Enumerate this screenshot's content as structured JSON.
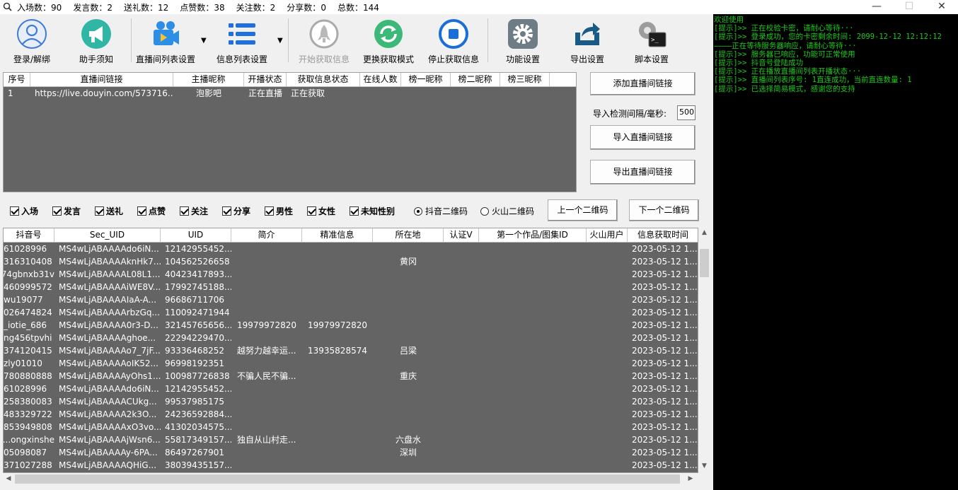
{
  "titlebar": {
    "stats": [
      {
        "label": "入场数",
        "value": "90"
      },
      {
        "label": "发言数",
        "value": "2"
      },
      {
        "label": "送礼数",
        "value": "12"
      },
      {
        "label": "点赞数",
        "value": "38"
      },
      {
        "label": "关注数",
        "value": "2"
      },
      {
        "label": "分享数",
        "value": "0"
      },
      {
        "label": "总数",
        "value": "144"
      }
    ],
    "minimize": "—",
    "maximize": "☐",
    "close": "✕"
  },
  "toolbar": {
    "login": "登录/解绑",
    "help": "助手须知",
    "room_list_settings": "直播间列表设置",
    "info_list_settings": "信息列表设置",
    "start_fetch": "开始获取信息",
    "switch_mode": "更换获取模式",
    "stop_fetch": "停止获取信息",
    "function_settings": "功能设置",
    "export_settings": "导出设置",
    "script_settings": "脚本设置"
  },
  "room_table": {
    "headers": [
      "序号",
      "直播间链接",
      "主播昵称",
      "开播状态",
      "获取信息状态",
      "在线人数",
      "榜一昵称",
      "榜二昵称",
      "榜三昵称"
    ],
    "rows": [
      [
        "1",
        "https://live.douyin.com/573716...",
        "泡影吧",
        "正在直播",
        "正在获取",
        "",
        "",
        "",
        ""
      ]
    ]
  },
  "right_panel": {
    "add_link": "添加直播间链接",
    "interval_label": "导入检测间隔/毫秒:",
    "interval_value": "500",
    "import_link": "导入直播间链接",
    "export_link": "导出直播间链接"
  },
  "filters": {
    "checkboxes": [
      "入场",
      "发言",
      "送礼",
      "点赞",
      "关注",
      "分享",
      "男性",
      "女性",
      "未知性别"
    ],
    "radio_douyin": "抖音二维码",
    "radio_huoshan": "火山二维码",
    "prev_qr": "上一个二维码",
    "next_qr": "下一个二维码"
  },
  "info_table": {
    "headers": [
      "抖音号",
      "Sec_UID",
      "UID",
      "简介",
      "精准信息",
      "所在地",
      "认证V",
      "第一个作品/图集ID",
      "火山用户",
      "信息获取时间"
    ],
    "rows": [
      [
        "61028996",
        "MS4wLjABAAAAdo6iN...",
        "12142955452...",
        "",
        "",
        "",
        "",
        "",
        "",
        "2023-05-12 1..."
      ],
      [
        "316310408",
        "MS4wLjABAAAAknHk7...",
        "104562526658",
        "",
        "",
        "黄冈",
        "",
        "",
        "",
        "2023-05-12 1..."
      ],
      [
        "74gbnxb31v",
        "MS4wLjABAAAAL08L1...",
        "40423417893...",
        "",
        "",
        "",
        "",
        "",
        "",
        "2023-05-12 1..."
      ],
      [
        "460999572",
        "MS4wLjABAAAAiWE8V...",
        "17992745188...",
        "",
        "",
        "",
        "",
        "",
        "",
        "2023-05-12 1..."
      ],
      [
        "wu19077",
        "MS4wLjABAAAAIaA-A...",
        "96686711706",
        "",
        "",
        "",
        "",
        "",
        "",
        "2023-05-12 1..."
      ],
      [
        "026474824",
        "MS4wLjABAAAArbzGq...",
        "110092471944",
        "",
        "",
        "",
        "",
        "",
        "",
        "2023-05-12 1..."
      ],
      [
        "iotie_686_",
        "MS4wLjABAAAA0r3-D...",
        "32145765656...",
        "19979972820",
        "19979972820",
        "",
        "",
        "",
        "",
        "2023-05-12 1..."
      ],
      [
        "ng456tpvhi",
        "MS4wLjABAAAAghoe...",
        "22294229470...",
        "",
        "",
        "",
        "",
        "",
        "",
        "2023-05-12 1..."
      ],
      [
        "374120415",
        "MS4wLjABAAAAo7_7jF...",
        "93336468252",
        "越努力越幸运...",
        "13935828574",
        "吕梁",
        "",
        "",
        "",
        "2023-05-12 1..."
      ],
      [
        "zly01010",
        "MS4wLjABAAAAoIK52...",
        "96998192351",
        "",
        "",
        "",
        "",
        "",
        "",
        "2023-05-12 1..."
      ],
      [
        "780880888",
        "MS4wLjABAAAAyOhs1...",
        "100987726838",
        "不骗人民不骗...",
        "",
        "重庆",
        "",
        "",
        "",
        "2023-05-12 1..."
      ],
      [
        "61028996",
        "MS4wLjABAAAAdo6iN...",
        "12142955452...",
        "",
        "",
        "",
        "",
        "",
        "",
        "2023-05-12 1..."
      ],
      [
        "258380083",
        "MS4wLjABAAAACUkg...",
        "99537985175",
        "",
        "",
        "",
        "",
        "",
        "",
        "2023-05-12 1..."
      ],
      [
        "483329722",
        "MS4wLjABAAAA2k3O...",
        "24236592884...",
        "",
        "",
        "",
        "",
        "",
        "",
        "2023-05-12 1..."
      ],
      [
        "853949808",
        "MS4wLjABAAAAxO3vo...",
        "41302034575...",
        "",
        "",
        "",
        "",
        "",
        "",
        "2023-05-12 1..."
      ],
      [
        "ongxinshe...",
        "MS4wLjABAAAAjWsn6...",
        "55817349157...",
        "独自从山村走...",
        "",
        "六盘水",
        "",
        "",
        "",
        "2023-05-12 1..."
      ],
      [
        "05098087",
        "MS4wLjABAAAAy-6PA...",
        "86497267901",
        "",
        "",
        "深圳",
        "",
        "",
        "",
        "2023-05-12 1..."
      ],
      [
        "371027288",
        "MS4wLjABAAAAQHiG...",
        "38039435157...",
        "",
        "",
        "",
        "",
        "",
        "",
        "2023-05-12 1..."
      ]
    ]
  },
  "console": {
    "lines": [
      "欢迎使用",
      "[提示]>> 正在校验卡密，请耐心等待···",
      "[提示]>> 登录成功，您的卡密剩余时间: 2099-12-12 12:12:12",
      "————正在等待服务器响应，请耐心等待···",
      "[提示]>> 服务器已响应，功能可正常使用",
      "[提示]>> 抖音号登陆成功",
      "[提示]>> 正在播放直播间列表开播状态···",
      "[提示]>> 直播间列表序号: 1直连成功，当前直连数量: 1",
      "[提示]>> 已选择简易模式，感谢您的支持"
    ]
  },
  "colors": {
    "grid_bg": "#646464",
    "console_bg": "#000000",
    "console_fg": "#1ec91e",
    "accent_blue": "#1e5fd6"
  }
}
